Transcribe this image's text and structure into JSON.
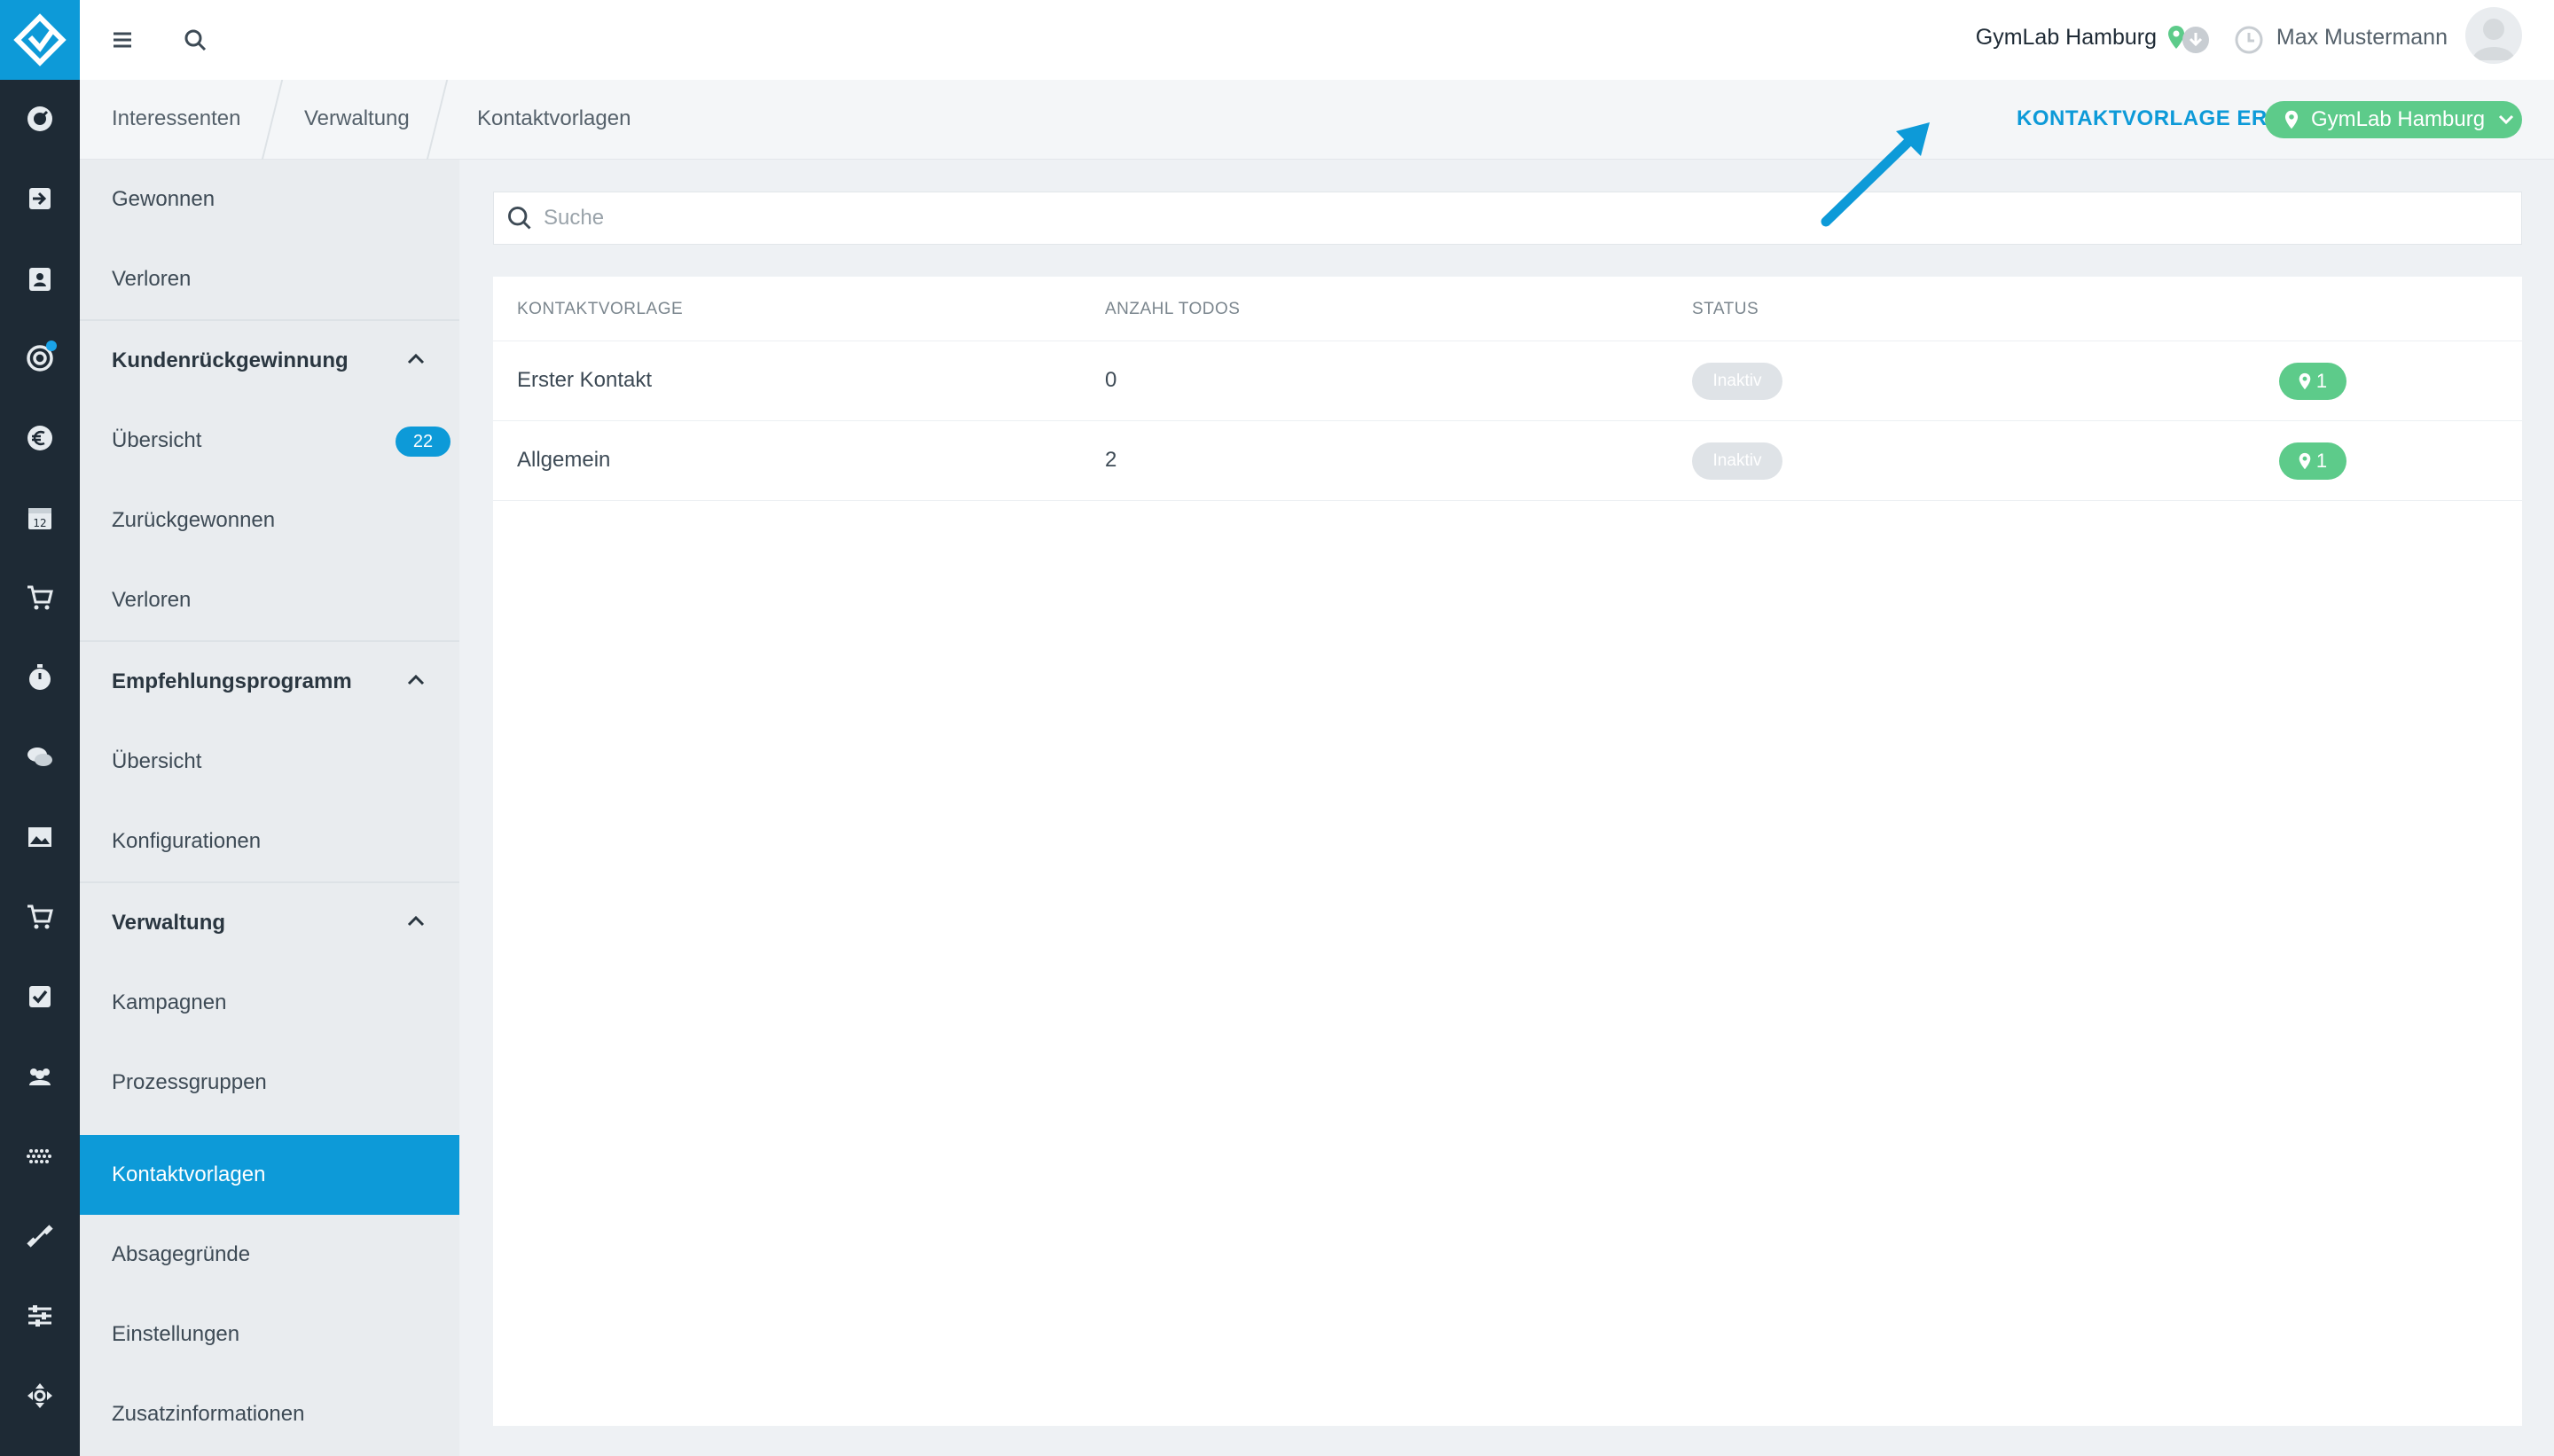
{
  "topbar": {
    "studio": "GymLab Hamburg",
    "user": "Max Mustermann"
  },
  "breadcrumb": [
    "Interessenten",
    "Verwaltung",
    "Kontaktvorlagen"
  ],
  "actions": {
    "create": "KONTAKTVORLAGE ERSTELLEN",
    "studio_select": "GymLab Hamburg"
  },
  "sidebar": {
    "items": [
      {
        "label": "Gewonnen"
      },
      {
        "label": "Verloren"
      },
      {
        "label": "Kundenrückgewinnung"
      },
      {
        "label": "Übersicht",
        "badge": "22"
      },
      {
        "label": "Zurückgewonnen"
      },
      {
        "label": "Verloren"
      },
      {
        "label": "Empfehlungsprogramm"
      },
      {
        "label": "Übersicht"
      },
      {
        "label": "Konfigurationen"
      },
      {
        "label": "Verwaltung"
      },
      {
        "label": "Kampagnen"
      },
      {
        "label": "Prozessgruppen"
      },
      {
        "label": "Kontaktvorlagen"
      },
      {
        "label": "Absagegründe"
      },
      {
        "label": "Einstellungen"
      },
      {
        "label": "Zusatzinformationen"
      }
    ]
  },
  "search": {
    "placeholder": "Suche"
  },
  "table": {
    "headers": [
      "KONTAKTVORLAGE",
      "ANZAHL TODOS",
      "STATUS"
    ],
    "rows": [
      {
        "name": "Erster Kontakt",
        "todos": "0",
        "status": "Inaktiv",
        "locations": "1"
      },
      {
        "name": "Allgemein",
        "todos": "2",
        "status": "Inaktiv",
        "locations": "1"
      }
    ]
  },
  "colors": {
    "accent": "#0d9ad8",
    "success": "#5dcb8a",
    "rail": "#1e2a35"
  }
}
